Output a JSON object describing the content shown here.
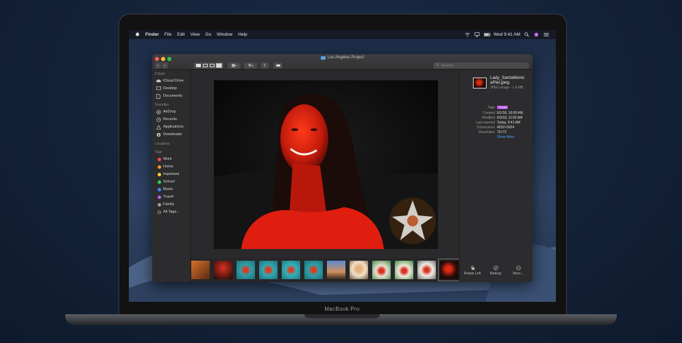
{
  "menubar": {
    "app": "Finder",
    "menus": [
      "File",
      "Edit",
      "View",
      "Go",
      "Window",
      "Help"
    ],
    "clock": "Wed 9:41 AM"
  },
  "window": {
    "title": "Los Angeles Project",
    "search_placeholder": "Search"
  },
  "sidebar": {
    "sections": {
      "icloud": "iCloud",
      "favorites": "Favorites",
      "locations": "Locations",
      "tags": "Tags"
    },
    "icloud_items": [
      "iCloud Drive",
      "Desktop",
      "Documents"
    ],
    "favorite_items": [
      "AirDrop",
      "Recents",
      "Applications",
      "Downloads"
    ],
    "tag_items": [
      {
        "label": "Work",
        "color": "#ff4a4a"
      },
      {
        "label": "Home",
        "color": "#ff9a2e"
      },
      {
        "label": "Important",
        "color": "#ffd12e"
      },
      {
        "label": "School",
        "color": "#3ccf4e"
      },
      {
        "label": "Music",
        "color": "#3a8cff"
      },
      {
        "label": "Travel",
        "color": "#c060f0"
      },
      {
        "label": "Family",
        "color": "#a0a0a0"
      },
      {
        "label": "All Tags...",
        "color": "#7a7a7a"
      }
    ]
  },
  "info": {
    "filename": "Lady_SantaMonicaPier.jpeg",
    "filename_line1": "Lady_SantaMonic",
    "filename_line2": "aPier.jpeg",
    "kind": "JPEG image - 1.4 MB",
    "rows": [
      {
        "key": "Tags",
        "value": "Travel"
      },
      {
        "key": "Created",
        "value": "6/1/18, 10:09 AM"
      },
      {
        "key": "Modified",
        "value": "6/3/18, 11:56 AM"
      },
      {
        "key": "Last opened",
        "value": "Today, 9:41 AM"
      },
      {
        "key": "Dimensions",
        "value": "4032×3024"
      },
      {
        "key": "Resolution",
        "value": "72×72"
      }
    ],
    "show_more": "Show More",
    "tag_color": "#b14ee0"
  },
  "actions": [
    "Rotate Left",
    "Markup",
    "More..."
  ],
  "device": {
    "brand": "MacBook Pro"
  }
}
